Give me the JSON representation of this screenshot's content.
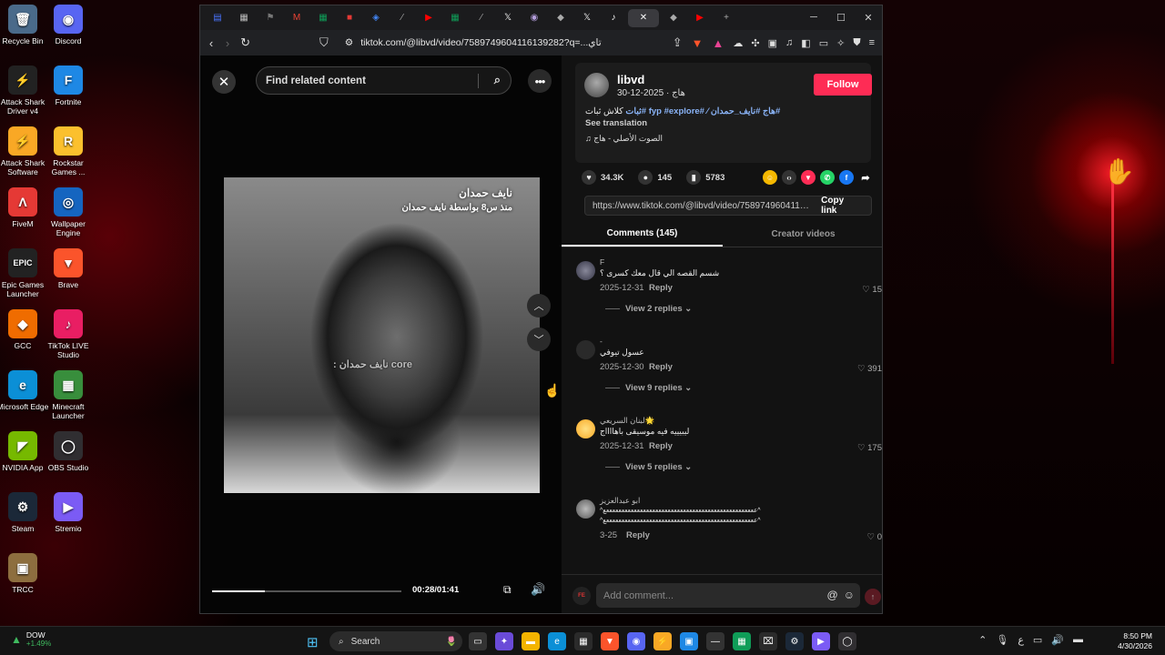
{
  "desktop": {
    "icons": [
      {
        "label": "Recycle Bin",
        "glyph": "🗑",
        "color": "#4a6a8a"
      },
      {
        "label": "Discord",
        "glyph": "◉",
        "color": "#5865f2"
      },
      {
        "label": "Attack Shark Driver v4",
        "glyph": "⚡",
        "color": "#222"
      },
      {
        "label": "Fortnite",
        "glyph": "F",
        "color": "#1e88e5"
      },
      {
        "label": "Attack Shark Software",
        "glyph": "⚡",
        "color": "#f9a825"
      },
      {
        "label": "Rockstar Games ...",
        "glyph": "R",
        "color": "#fbc02d"
      },
      {
        "label": "FiveM",
        "glyph": "Λ",
        "color": "#e53935"
      },
      {
        "label": "Wallpaper Engine",
        "glyph": "◎",
        "color": "#1565c0"
      },
      {
        "label": "Epic Games Launcher",
        "glyph": "EPIC",
        "color": "#222"
      },
      {
        "label": "Brave",
        "glyph": "▼",
        "color": "#fb542b"
      },
      {
        "label": "GCC",
        "glyph": "◆",
        "color": "#ef6c00"
      },
      {
        "label": "TikTok LIVE Studio",
        "glyph": "♪",
        "color": "#e91e63"
      },
      {
        "label": "Microsoft Edge",
        "glyph": "e",
        "color": "#0b8fd6"
      },
      {
        "label": "Minecraft Launcher",
        "glyph": "▦",
        "color": "#388e3c"
      },
      {
        "label": "NVIDIA App",
        "glyph": "◤",
        "color": "#76b900"
      },
      {
        "label": "OBS Studio",
        "glyph": "◯",
        "color": "#302e31"
      },
      {
        "label": "Steam",
        "glyph": "⚙",
        "color": "#1b2838"
      },
      {
        "label": "Stremio",
        "glyph": "▶",
        "color": "#7b5bf5"
      },
      {
        "label": "TRCC",
        "glyph": "▣",
        "color": "#8d6e3f"
      }
    ]
  },
  "browser": {
    "url": "tiktok.com/@libvd/video/7589749604116139282?q=...تاي",
    "close_tab": "✕",
    "new_tab": "+"
  },
  "video": {
    "search_placeholder": "Find related content",
    "overlay_name": "نايف حمدان",
    "overlay_sub": "منذ س8 بواسطة نايف حمدان",
    "caption": "core نايف حمدان :",
    "time": "00:28/01:41",
    "progress": 0.28
  },
  "post": {
    "username": "libvd",
    "meta": "هاج · 2025-12-30",
    "follow_label": "Follow",
    "desc_text": "كلاش ثبات",
    "desc_tags": "#هاج #نايف_حمدان ⁄ #fyp #explore #ثبات",
    "see_translation": "See translation",
    "sound": "♫  الصوت الأصلي - هاج",
    "likes": "34.3K",
    "comments": "145",
    "saves": "5783",
    "link": "https://www.tiktok.com/@libvd/video/75897496041161...",
    "copy_link": "Copy link",
    "tab_comments": "Comments (145)",
    "tab_creator": "Creator videos"
  },
  "comments": [
    {
      "name": "F",
      "text": "شسم القصه الي قال معك كسرى ؟",
      "date": "2025-12-31",
      "reply": "Reply",
      "likes": "♡ 15",
      "replies": "View 2 replies ⌄"
    },
    {
      "name": "-",
      "text": "عسول تيوفي",
      "date": "2025-12-30",
      "reply": "Reply",
      "likes": "♡ 391",
      "replies": "View 9 replies ⌄"
    },
    {
      "name": "لبنان السريعي🌟",
      "text": "ليبيييه فيه موسيقى باهااااج",
      "date": "2025-12-31",
      "reply": "Reply",
      "likes": "♡ 175",
      "replies": "View 5 replies ⌄"
    },
    {
      "name": "ابو عبدالعزيز",
      "text": "^عععععععععععععععععععععععععععععععععععععععععععععععععع^",
      "text2": "^عععععععععععععععععععععععععععععععععععععععععععععععععع^",
      "date": "3-25",
      "reply": "Reply",
      "likes": "♡ 0"
    }
  ],
  "comment_bar": {
    "placeholder": "Add comment...",
    "avatar_text": "FE"
  },
  "taskbar": {
    "ticker": "DOW",
    "change": "+1.49%",
    "search": "Search",
    "time": "8:50 PM",
    "date": "4/30/2026"
  }
}
